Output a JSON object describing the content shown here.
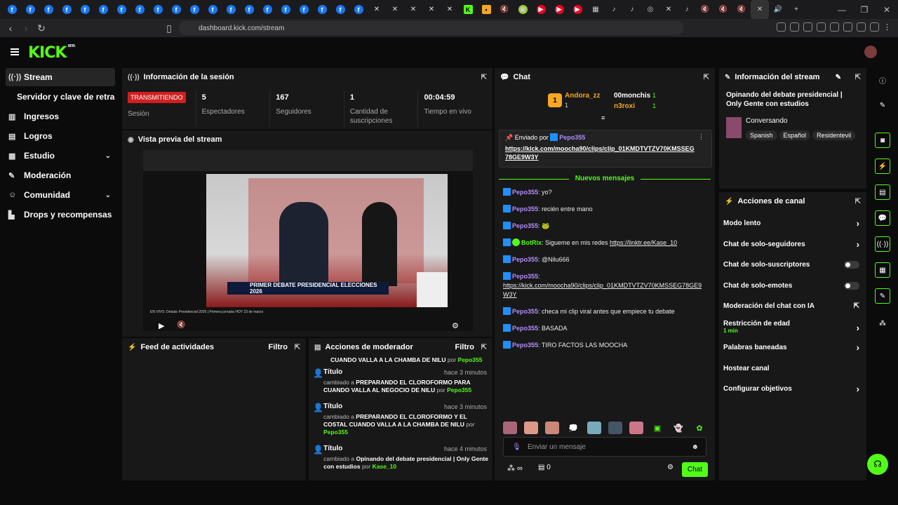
{
  "browser": {
    "url": "dashboard.kick.com/stream"
  },
  "app": {
    "logo": "KICK",
    "logo_badge": "BETA"
  },
  "sidebar": {
    "items": [
      {
        "label": "Stream",
        "icon": "broadcast-icon"
      },
      {
        "label": "Servidor y clave de retransm",
        "icon": ""
      },
      {
        "label": "Ingresos",
        "icon": "revenue-icon"
      },
      {
        "label": "Logros",
        "icon": "trophy-icon"
      },
      {
        "label": "Estudio",
        "icon": "studio-icon"
      },
      {
        "label": "Moderación",
        "icon": "wrench-icon"
      },
      {
        "label": "Comunidad",
        "icon": "people-icon"
      },
      {
        "label": "Drops y recompensas",
        "icon": "gift-icon"
      }
    ]
  },
  "session": {
    "title": "Información de la sesión",
    "live_badge": "TRANSMITIENDO",
    "live_label": "Sesión",
    "viewers_value": "5",
    "viewers_label": "Espectadores",
    "followers_value": "167",
    "followers_label": "Seguidores",
    "subs_value": "1",
    "subs_label": "Cantidad de suscripciones",
    "time_value": "00:04:59",
    "time_label": "Tiempo en vivo"
  },
  "preview": {
    "title": "Vista previa del stream",
    "banner": "PRIMER DEBATE PRESIDENCIAL ELECCIONES 2026",
    "video_caption": "EN VIVO: Debate Presidencial 2026 | Primera jornada HOY 23 de marzo"
  },
  "activity": {
    "title": "Feed de actividades",
    "filter": "Filtro"
  },
  "modactions": {
    "title": "Acciones de moderador",
    "filter": "Filtro",
    "top_partial": "CUANDO VALLA A LA CHAMBA DE NILU",
    "top_partial_by": "por",
    "top_partial_user": "Pepo355",
    "items": [
      {
        "title": "Título",
        "time": "hace 3 minutos",
        "prefix": "cambiado a",
        "text": "PREPARANDO EL CLOROFORMO PARA CUANDO VALLA AL NEGOCIO DE NILU",
        "by": "por",
        "user": "Pepo355"
      },
      {
        "title": "Título",
        "time": "hace 3 minutos",
        "prefix": "cambiado a",
        "text": "PREPARANDO EL CLOROFORMO Y EL COSTAL CUANDO VALLA A LA CHAMBA DE NILU",
        "by": "por",
        "user": "Pepo355"
      },
      {
        "title": "Título",
        "time": "hace 4 minutos",
        "prefix": "cambiado a",
        "text": "Opinando del debate presidencial | Only Gente con estudios",
        "by": "por",
        "user": "Kase_10"
      }
    ]
  },
  "chat": {
    "title": "Chat",
    "top_gifter": "Andora_zz",
    "top_gifter_count": "1",
    "top_gifter_rank": "1",
    "gifter2": "00monchis",
    "gifter2_count": "1",
    "gifter3": "n3roxi",
    "gifter3_count": "1",
    "pinned_by_label": "Enviado por",
    "pinned_by": "Pepo355",
    "pinned_link": "https://kick.com/moocha90/clips/clip_01KMDTVTZV70KMSSEG78GE9W3Y",
    "new_messages": "Nuevos mensajes",
    "messages": [
      {
        "user": "Pepo355",
        "text": ": yo?"
      },
      {
        "user": "Pepo355",
        "text": ": recién entre mano"
      },
      {
        "user": "Pepo355",
        "text": ": 🐸"
      },
      {
        "user": "BotRix",
        "text": ": Sigueme en mis redes ",
        "link": "https://linktr.ee/Kase_10"
      },
      {
        "user": "Pepo355",
        "text": ": @Nilu666"
      },
      {
        "user": "Pepo355",
        "text": ":",
        "link": "https://kick.com/moocha90/clips/clip_01KMDTVTZV70KMSSEG78GE9W3Y"
      },
      {
        "user": "Pepo355",
        "text": ": checa mi clip viral antes que empiece tu debate"
      },
      {
        "user": "Pepo355",
        "text": ": BASADA"
      },
      {
        "user": "Pepo355",
        "text": ": TIRO FACTOS LAS MOOCHA"
      }
    ],
    "placeholder": "Enviar un mensaje",
    "points": "0",
    "send": "Chat"
  },
  "stream_info": {
    "title": "Información del stream",
    "stream_title": "Opinando del debate presidencial | Only Gente con estudios",
    "category": "Conversando",
    "tags": [
      "Spanish",
      "Español",
      "Residentevil"
    ]
  },
  "channel_actions": {
    "title": "Acciones de canal",
    "items": [
      {
        "label": "Modo lento",
        "control": "arrow"
      },
      {
        "label": "Chat de solo-seguidores",
        "control": "arrow"
      },
      {
        "label": "Chat de solo-suscriptores",
        "control": "toggle"
      },
      {
        "label": "Chat de solo-emotes",
        "control": "toggle"
      },
      {
        "label": "Moderación del chat con IA",
        "control": "link"
      },
      {
        "label": "Restricción de edad",
        "sub": "1 min",
        "control": "arrow"
      },
      {
        "label": "Palabras baneadas",
        "control": "arrow"
      },
      {
        "label": "Hostear canal",
        "control": "none"
      },
      {
        "label": "Configurar objetivos",
        "control": "arrow"
      }
    ]
  },
  "colors": {
    "accent": "#53fc18",
    "live": "#d21f1f",
    "username": "#b38cff"
  }
}
